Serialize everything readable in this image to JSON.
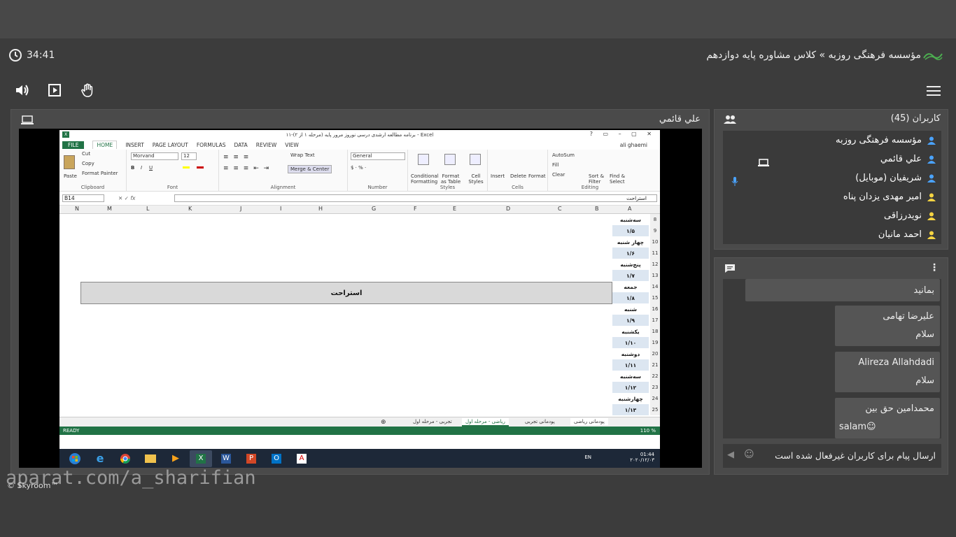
{
  "app": {
    "class_title": "مؤسسه فرهنگی روزبه » کلاس مشاوره پایه دوازدهم",
    "timer": "34:41",
    "watermark": "aparat.com/a_sharifian",
    "skyroom": "© Skyroom™"
  },
  "share": {
    "presenter": "علي قائمي"
  },
  "users": {
    "title": "کاربران (45)",
    "list": [
      {
        "name": "مؤسسه فرهنگی روزبه",
        "color": "#4aa3ff"
      },
      {
        "name": "علي قائمي",
        "color": "#4aa3ff"
      },
      {
        "name": "شريفيان (موبايل)",
        "color": "#4aa3ff"
      },
      {
        "name": "امیر مهدی یزدان پناه",
        "color": "#f5d442"
      },
      {
        "name": "نویدرزاقی",
        "color": "#f5d442"
      },
      {
        "name": "احمد مانيان",
        "color": "#f5d442"
      }
    ]
  },
  "chat": {
    "partial": "بمانید",
    "messages": [
      {
        "author": "عليرضا تهامى",
        "text": "سلام"
      },
      {
        "author": "Alireza Allahdadi",
        "text": "سلام"
      },
      {
        "author": "محمدامين حق بين",
        "text": "salam☺"
      }
    ],
    "placeholder": "ارسال پیام برای کاربران غیرفعال شده است"
  },
  "excel": {
    "title": "۱۱-برنامه مطالعه ارشدی درسی نوروز مرور پایه (مرحله ۱ از ۲) - Excel",
    "user": "ali ghaemi",
    "tabs": [
      "FILE",
      "HOME",
      "INSERT",
      "PAGE LAYOUT",
      "FORMULAS",
      "DATA",
      "REVIEW",
      "VIEW"
    ],
    "clipboard": {
      "cut": "Cut",
      "copy": "Copy",
      "painter": "Format Painter",
      "paste": "Paste",
      "label": "Clipboard"
    },
    "font": {
      "name": "Morvand",
      "size": "12",
      "label": "Font"
    },
    "alignment": {
      "wrap": "Wrap Text",
      "merge": "Merge & Center",
      "label": "Alignment"
    },
    "number": {
      "format": "General",
      "label": "Number"
    },
    "styles": {
      "cond": "Conditional Formatting",
      "table": "Format as Table",
      "cell": "Cell Styles",
      "label": "Styles"
    },
    "cells": {
      "insert": "Insert",
      "delete": "Delete",
      "format": "Format",
      "label": "Cells"
    },
    "editing": {
      "autosum": "AutoSum",
      "fill": "Fill",
      "clear": "Clear",
      "sort": "Sort & Filter",
      "find": "Find & Select",
      "label": "Editing"
    },
    "namebox": "B14",
    "formula": "استراحت",
    "columns": [
      "N",
      "M",
      "L",
      "K",
      "J",
      "I",
      "H",
      "G",
      "F",
      "E",
      "D",
      "C",
      "B",
      "A"
    ],
    "rows": [
      "8",
      "9",
      "10",
      "11",
      "12",
      "13",
      "14",
      "15",
      "16",
      "17",
      "18",
      "19",
      "20",
      "21",
      "22",
      "23",
      "24",
      "25"
    ],
    "days": [
      {
        "day": "سه‌شنبه",
        "date": "۱/۵"
      },
      {
        "day": "چهار شنبه",
        "date": "۱/۶"
      },
      {
        "day": "پنج‌شنبه",
        "date": "۱/۷"
      },
      {
        "day": "جمعه",
        "date": "۱/۸"
      },
      {
        "day": "شنبه",
        "date": "۱/۹"
      },
      {
        "day": "یکشنبه",
        "date": "۱/۱۰"
      },
      {
        "day": "دوشنبه",
        "date": "۱/۱۱"
      },
      {
        "day": "سه‌شنبه",
        "date": "۱/۱۲"
      },
      {
        "day": "چهارشنبه",
        "date": "۱/۱۳"
      }
    ],
    "rest_banner": "استراحت",
    "sheets": [
      "پودمانی ریاضی",
      "پودمانی تجربی",
      "ریاضی - مرحله اول",
      "تجربی - مرحله اول"
    ],
    "status_ready": "READY",
    "zoom": "110 %"
  },
  "taskbar": {
    "lang": "EN",
    "time": "01:44",
    "date": "۲۰۲۰/۱۲/۰۳"
  }
}
